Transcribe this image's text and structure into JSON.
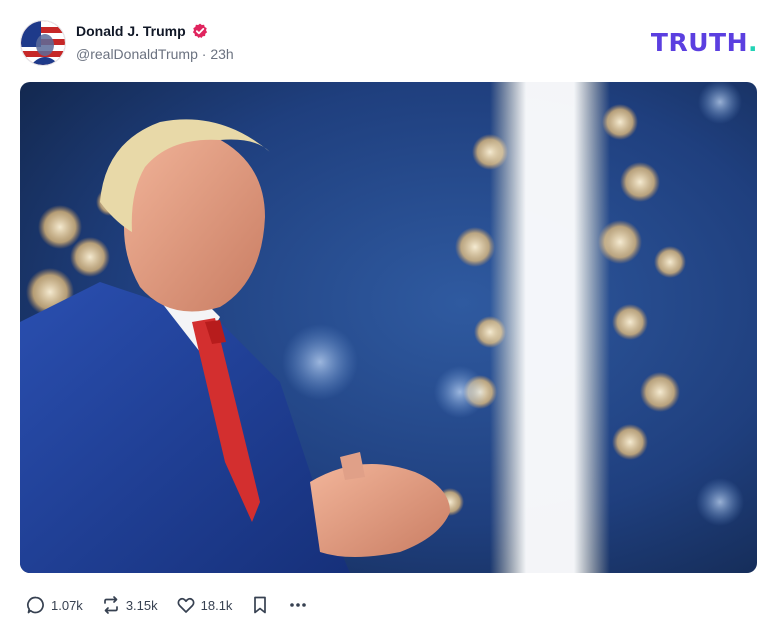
{
  "post": {
    "author": {
      "display_name": "Donald J. Trump",
      "handle": "@realDonaldTrump",
      "time_ago": "23h",
      "separator": " · ",
      "verified": true
    },
    "brand": {
      "logo_text": "TRUTH",
      "logo_dot": ".",
      "accent_color": "#5b3fe0",
      "dot_color": "#22d3b5"
    },
    "media": {
      "type": "photo"
    },
    "actions": {
      "replies_count": "1.07k",
      "retruths_count": "3.15k",
      "likes_count": "18.1k"
    }
  },
  "icons": [
    "verified-badge-icon",
    "reply-icon",
    "retruth-icon",
    "like-icon",
    "bookmark-icon",
    "more-icon"
  ]
}
